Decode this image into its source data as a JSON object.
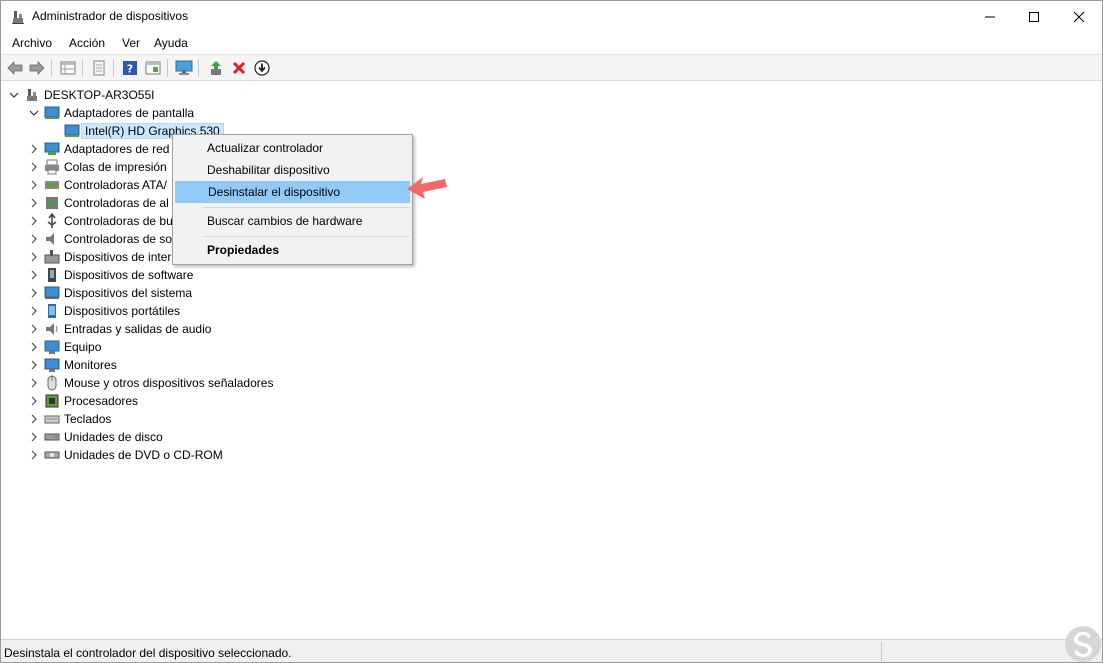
{
  "window": {
    "title": "Administrador de dispositivos"
  },
  "menubar": {
    "items": [
      "Archivo",
      "Acción",
      "Ver",
      "Ayuda"
    ]
  },
  "toolbar": {
    "icons": [
      "back-arrow-icon",
      "forward-arrow-icon",
      "properties-grid-icon",
      "document-icon",
      "help-icon",
      "view-icon",
      "monitor-scan-icon",
      "update-driver-icon",
      "uninstall-x-icon",
      "download-icon"
    ]
  },
  "tree": {
    "root": "DESKTOP-AR3O55I",
    "expanded_category": "Adaptadores de pantalla",
    "selected_device": "Intel(R) HD Graphics 530",
    "categories": [
      "Adaptadores de red",
      "Colas de impresión",
      "Controladoras ATA/ATAPI IDE",
      "Controladoras de almacenamiento",
      "Controladoras de bus serie universal",
      "Controladoras de sonido y vídeo y dispositivos de juego",
      "Dispositivos de interfaz de usuario (HID)",
      "Dispositivos de software",
      "Dispositivos del sistema",
      "Dispositivos portátiles",
      "Entradas y salidas de audio",
      "Equipo",
      "Monitores",
      "Mouse y otros dispositivos señaladores",
      "Procesadores",
      "Teclados",
      "Unidades de disco",
      "Unidades de DVD o CD-ROM"
    ],
    "truncated_labels": [
      "Adaptadores de red",
      "Colas de impresión",
      "Controladoras ATA/",
      "Controladoras de al",
      "Controladoras de bu",
      "Controladoras de so",
      "Dispositivos de inter",
      "Dispositivos de software",
      "Dispositivos del sistema",
      "Dispositivos portátiles",
      "Entradas y salidas de audio",
      "Equipo",
      "Monitores",
      "Mouse y otros dispositivos señaladores",
      "Procesadores",
      "Teclados",
      "Unidades de disco",
      "Unidades de DVD o CD-ROM"
    ]
  },
  "context_menu": {
    "items": [
      "Actualizar controlador",
      "Deshabilitar dispositivo",
      "Desinstalar el dispositivo",
      "Buscar cambios de hardware",
      "Propiedades"
    ],
    "highlighted": "Desinstalar el dispositivo"
  },
  "statusbar": {
    "text": "Desinstala el controlador del dispositivo seleccionado."
  },
  "colors": {
    "highlight": "#91c9f7",
    "selection": "#cce8ff",
    "arrow": "#f06a6a"
  }
}
